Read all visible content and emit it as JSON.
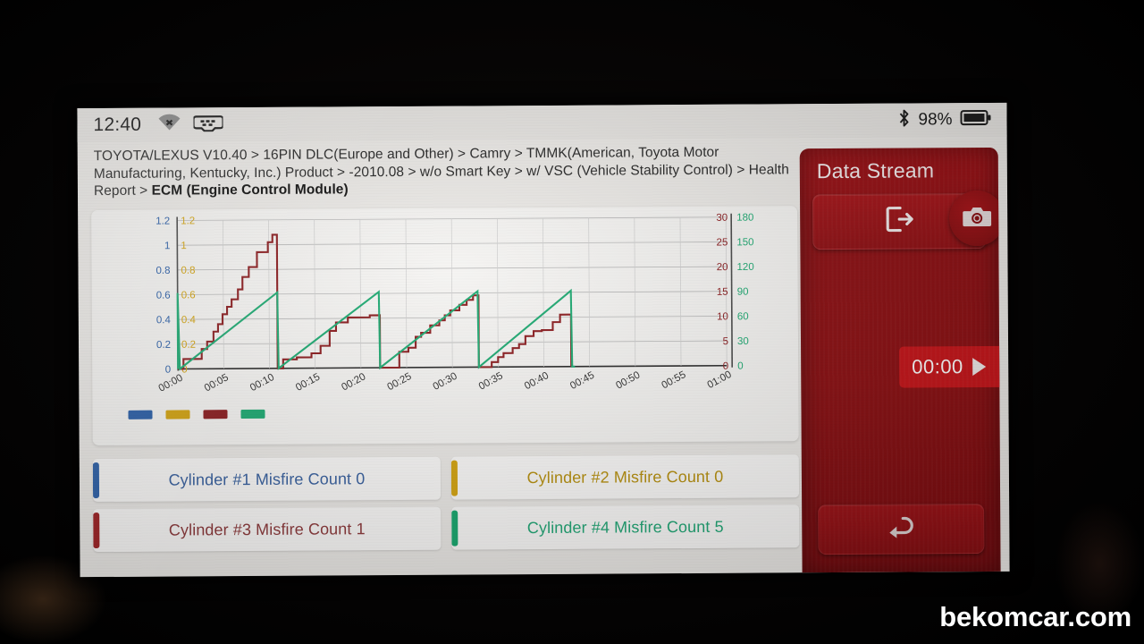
{
  "statusbar": {
    "clock": "12:40",
    "wifi_icon": "wifi-off-icon",
    "connector_icon": "obd-connector-icon",
    "bluetooth_icon": "bluetooth-icon",
    "battery_percent": "98%",
    "battery_icon": "battery-full-icon"
  },
  "breadcrumb": {
    "path": "TOYOTA/LEXUS V10.40 > 16PIN DLC(Europe and Other) > Camry > TMMK(American, Toyota Motor Manufacturing, Kentucky, Inc.) Product > -2010.08 > w/o Smart Key > w/ VSC (Vehicle Stability Control) > Health Report > ",
    "current": "ECM (Engine Control Module)"
  },
  "colors": {
    "series_blue": "#2b5fa8",
    "series_gold": "#d4a412",
    "series_darkred": "#8d1f22",
    "series_green": "#21ab74",
    "panel_red": "#8e1014",
    "chip_red": "#c7151a"
  },
  "chart_data": {
    "type": "line",
    "title": "",
    "xlabel": "",
    "ylabel": "",
    "grid": true,
    "legend_position": "bottom-left",
    "x_ticks": [
      "00:00",
      "00:05",
      "00:10",
      "00:15",
      "00:20",
      "00:25",
      "00:30",
      "00:35",
      "00:40",
      "00:45",
      "00:50",
      "00:55",
      "01:00"
    ],
    "xlim": [
      0,
      60
    ],
    "axes": [
      {
        "name": "Cylinder #1 Misfire Count",
        "color": "#2b5fa8",
        "side": "left",
        "ticks": [
          "0",
          "0.2",
          "0.4",
          "0.6",
          "0.8",
          "1",
          "1.2"
        ],
        "lim": [
          0,
          1.2
        ]
      },
      {
        "name": "Cylinder #2 Misfire Count",
        "color": "#d4a412",
        "side": "left",
        "ticks": [
          "0",
          "0.2",
          "0.4",
          "0.6",
          "0.8",
          "1",
          "1.2"
        ],
        "lim": [
          0,
          1.2
        ]
      },
      {
        "name": "Cylinder #3 Misfire Count",
        "color": "#8d1f22",
        "side": "right",
        "ticks": [
          "0",
          "5",
          "10",
          "15",
          "20",
          "25",
          "30"
        ],
        "lim": [
          0,
          30
        ]
      },
      {
        "name": "Cylinder #4 Misfire Count",
        "color": "#21ab74",
        "side": "right",
        "ticks": [
          "0",
          "30",
          "60",
          "90",
          "120",
          "150",
          "180"
        ],
        "lim": [
          0,
          180
        ]
      }
    ],
    "series": [
      {
        "name": "Cylinder #1 Misfire Count",
        "color": "#2b5fa8",
        "axis": "left-blue",
        "visible": false,
        "points": []
      },
      {
        "name": "Cylinder #2 Misfire Count",
        "color": "#d4a412",
        "axis": "left-gold",
        "visible": false,
        "points": []
      },
      {
        "name": "Cylinder #3 Misfire Count",
        "color": "#8d1f22",
        "axis": "right-0-30",
        "style": "step",
        "visible": true,
        "points": [
          [
            0,
            0
          ],
          [
            0.6,
            0
          ],
          [
            0.6,
            2
          ],
          [
            2.2,
            2
          ],
          [
            2.2,
            2
          ],
          [
            2.6,
            2
          ],
          [
            2.6,
            4
          ],
          [
            3.2,
            4
          ],
          [
            3.2,
            5.5
          ],
          [
            3.9,
            5.5
          ],
          [
            3.9,
            7.5
          ],
          [
            4.4,
            7.5
          ],
          [
            4.4,
            9
          ],
          [
            4.9,
            9
          ],
          [
            4.9,
            11
          ],
          [
            5.4,
            11
          ],
          [
            5.4,
            12.5
          ],
          [
            5.9,
            12.5
          ],
          [
            5.9,
            14
          ],
          [
            6.6,
            14
          ],
          [
            6.6,
            16
          ],
          [
            7.1,
            16
          ],
          [
            7.1,
            18.5
          ],
          [
            7.8,
            18.5
          ],
          [
            7.8,
            20.5
          ],
          [
            8.7,
            20.5
          ],
          [
            8.7,
            23.5
          ],
          [
            9.9,
            23.5
          ],
          [
            9.9,
            25.5
          ],
          [
            10.4,
            25.5
          ],
          [
            10.4,
            27
          ],
          [
            10.9,
            27
          ],
          [
            10.9,
            0
          ],
          [
            11.5,
            0
          ],
          [
            11.5,
            1.8
          ],
          [
            13.0,
            1.8
          ],
          [
            13.0,
            2.2
          ],
          [
            14.6,
            2.2
          ],
          [
            14.6,
            3.0
          ],
          [
            15.6,
            3.0
          ],
          [
            15.6,
            4.5
          ],
          [
            16.6,
            4.5
          ],
          [
            16.6,
            7.5
          ],
          [
            17.3,
            7.5
          ],
          [
            17.3,
            9.2
          ],
          [
            18.6,
            9.2
          ],
          [
            18.6,
            10.2
          ],
          [
            21.0,
            10.2
          ],
          [
            21.0,
            10.6
          ],
          [
            22.1,
            10.6
          ],
          [
            22.1,
            0
          ],
          [
            24.2,
            0
          ],
          [
            24.2,
            3.2
          ],
          [
            25.2,
            3.2
          ],
          [
            25.2,
            4.0
          ],
          [
            26.0,
            4.0
          ],
          [
            26.0,
            6.2
          ],
          [
            26.6,
            6.2
          ],
          [
            26.6,
            7.0
          ],
          [
            27.6,
            7.0
          ],
          [
            27.6,
            8.5
          ],
          [
            28.6,
            8.5
          ],
          [
            28.6,
            9.5
          ],
          [
            29.2,
            9.5
          ],
          [
            29.2,
            10.5
          ],
          [
            29.8,
            10.5
          ],
          [
            29.8,
            11.5
          ],
          [
            30.8,
            11.5
          ],
          [
            30.8,
            12.6
          ],
          [
            31.6,
            12.6
          ],
          [
            31.6,
            13.6
          ],
          [
            32.3,
            13.6
          ],
          [
            32.3,
            14.5
          ],
          [
            32.9,
            14.5
          ],
          [
            32.9,
            0
          ],
          [
            34.3,
            0
          ],
          [
            34.3,
            1.0
          ],
          [
            35.0,
            1.0
          ],
          [
            35.0,
            2.0
          ],
          [
            35.6,
            2.0
          ],
          [
            35.6,
            2.8
          ],
          [
            36.6,
            2.8
          ],
          [
            36.6,
            3.8
          ],
          [
            37.3,
            3.8
          ],
          [
            37.3,
            4.6
          ],
          [
            38.0,
            4.6
          ],
          [
            38.0,
            6.2
          ],
          [
            38.9,
            6.2
          ],
          [
            38.9,
            7.2
          ],
          [
            39.8,
            7.2
          ],
          [
            39.8,
            7.4
          ],
          [
            41.0,
            7.4
          ],
          [
            41.0,
            9.0
          ],
          [
            41.8,
            9.0
          ],
          [
            41.8,
            10.5
          ],
          [
            43.0,
            10.5
          ],
          [
            43.0,
            0
          ]
        ]
      },
      {
        "name": "Cylinder #4 Misfire Count",
        "color": "#21ab74",
        "axis": "right-0-180",
        "style": "sawtooth",
        "visible": true,
        "points": [
          [
            0,
            0
          ],
          [
            0,
            92
          ],
          [
            0.2,
            0
          ],
          [
            10.9,
            92
          ],
          [
            11.0,
            0
          ],
          [
            22.0,
            92
          ],
          [
            22.1,
            0
          ],
          [
            32.8,
            92
          ],
          [
            32.9,
            0
          ],
          [
            43.0,
            92
          ],
          [
            43.1,
            0
          ],
          [
            43.4,
            0
          ]
        ]
      }
    ]
  },
  "cylinders": [
    {
      "label": "Cylinder #1 Misfire Count 0",
      "color": "#2b5fa8",
      "text_color": "#3a62a0"
    },
    {
      "label": "Cylinder #2 Misfire Count 0",
      "color": "#d4a412",
      "text_color": "#b8910f"
    },
    {
      "label": "Cylinder #3 Misfire Count 1",
      "color": "#9d1f22",
      "text_color": "#8d3a3c"
    },
    {
      "label": "Cylinder #4 Misfire Count 5",
      "color": "#19a86f",
      "text_color": "#22a776"
    }
  ],
  "panel": {
    "title": "Data Stream",
    "exit_icon": "exit-icon",
    "camera_icon": "camera-icon",
    "timer": "00:00",
    "play_icon": "play-icon",
    "back_icon": "back-arrow-icon"
  },
  "watermark": {
    "text": "bekomcar.com"
  }
}
